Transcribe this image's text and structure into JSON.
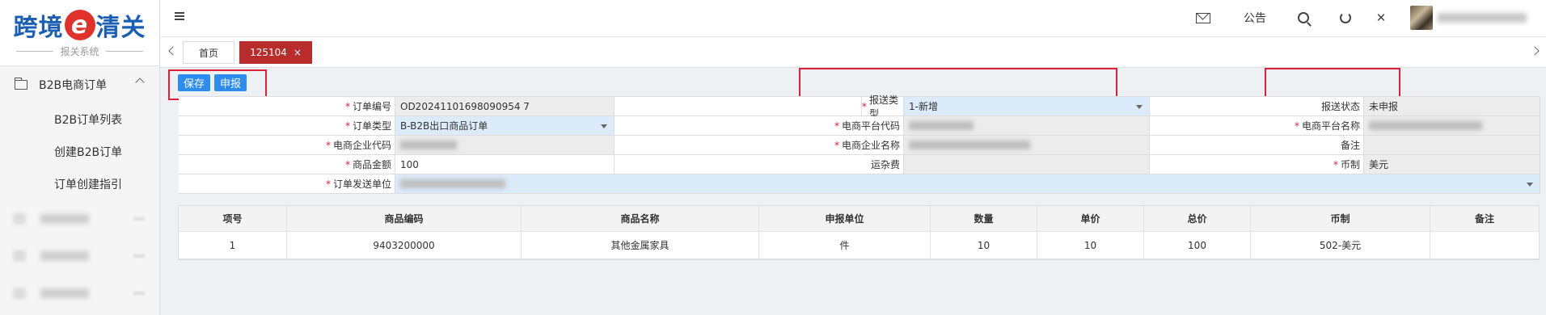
{
  "logo": {
    "part1": "跨境",
    "e": "e",
    "part2": "清关",
    "subtitle": "报关系统"
  },
  "sidebar": {
    "group_label": "B2B电商订单",
    "items": [
      {
        "label": "B2B订单列表"
      },
      {
        "label": "创建B2B订单"
      },
      {
        "label": "订单创建指引"
      }
    ]
  },
  "header": {
    "announcement": "公告"
  },
  "tabs": [
    {
      "label": "首页"
    },
    {
      "label": "125104",
      "close": "×"
    }
  ],
  "toolbar": {
    "save_label": "保存",
    "submit_label": "申报"
  },
  "form": {
    "order_no_label": "订单编号",
    "order_no_value": "OD20241101698090954 7",
    "declare_type_label": "报送类型",
    "declare_type_value": "1-新增",
    "declare_status_label": "报送状态",
    "declare_status_value": "未申报",
    "order_type_label": "订单类型",
    "order_type_value": "B-B2B出口商品订单",
    "platform_code_label": "电商平台代码",
    "platform_name_label": "电商平台名称",
    "enterprise_code_label": "电商企业代码",
    "enterprise_name_label": "电商企业名称",
    "remark_label": "备注",
    "goods_amount_label": "商品金额",
    "goods_amount_value": "100",
    "freight_label": "运杂费",
    "currency_label": "币制",
    "currency_value": "美元",
    "sender_label": "订单发送单位"
  },
  "table": {
    "headers": [
      "项号",
      "商品编码",
      "商品名称",
      "申报单位",
      "数量",
      "单价",
      "总价",
      "币制",
      "备注"
    ],
    "rows": [
      [
        "1",
        "9403200000",
        "其他金属家具",
        "件",
        "10",
        "10",
        "100",
        "502-美元",
        ""
      ]
    ]
  },
  "colors": {
    "brand_blue": "#1a5fb4",
    "logo_red": "#e0312a",
    "active_tab": "#b82c2c",
    "button_blue": "#2d8cf0",
    "highlight_box": "#e0203a"
  }
}
